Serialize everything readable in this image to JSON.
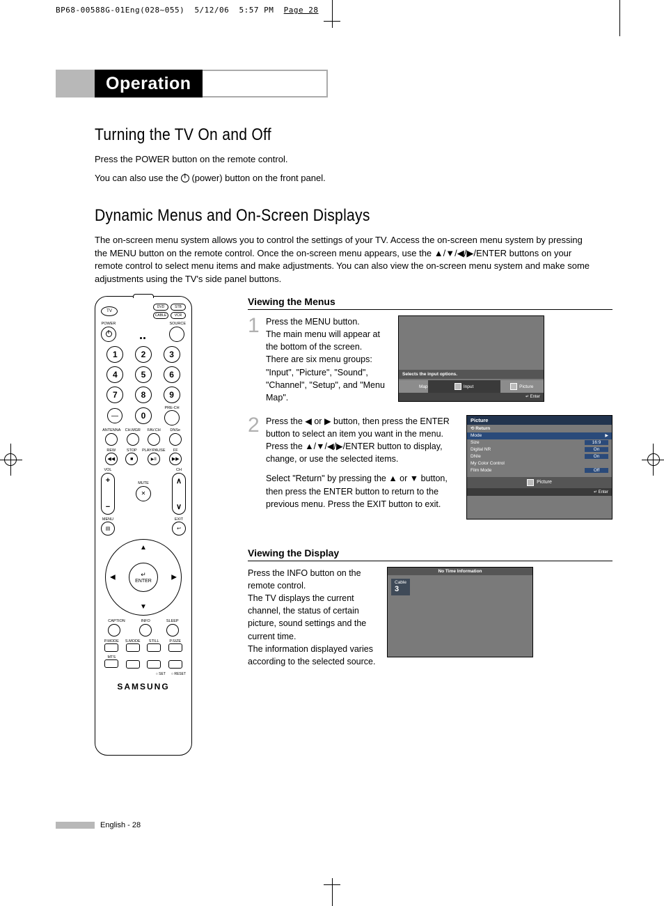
{
  "cropHeader": {
    "job": "BP68-00588G-01Eng(028~055)",
    "date": "5/12/06",
    "time": "5:57 PM",
    "page": "Page 28"
  },
  "sectionTitle": "Operation",
  "sub1": "Turning the TV On and Off",
  "sub1_p1": "Press the POWER button on the remote control.",
  "sub1_p2a": "You can also use the ",
  "sub1_p2b": " (power) button on the front panel.",
  "sub2": "Dynamic Menus and On-Screen Displays",
  "sub2_p": "The on-screen menu system allows you to control the settings of your TV. Access the on-screen menu system by pressing the MENU button on the remote control. Once the on-screen menu appears, use the ▲/▼/◀/▶/ENTER buttons on your remote control to select menu items and make adjustments. You can also view the on-screen menu system and make some adjustments using the TV's side panel buttons.",
  "viewingMenus": "Viewing the Menus",
  "step1_num": "1",
  "step1": "Press the MENU button.\nThe main menu will appear at the bottom of the screen.\nThere are six menu groups: \"Input\", \"Picture\", \"Sound\", \"Channel\", \"Setup\", and \"Menu Map\".",
  "step2_num": "2",
  "step2_p1": "Press the ◀ or ▶ button, then press the ENTER button to select an item you want in the menu.\nPress the ▲/▼/◀/▶/ENTER button to display, change, or use the selected items.",
  "step2_p2": "Select \"Return\" by pressing the ▲ or ▼ button, then press the ENTER button to return to the previous menu. Press the EXIT button to exit.",
  "viewingDisplay": "Viewing the Display",
  "disp_p": "Press the INFO button on the remote control.\nThe TV displays the current channel, the status of certain picture, sound settings and the current time.\nThe information displayed varies according to the selected source.",
  "remote": {
    "tv": "TV",
    "dvd": "DVD",
    "stb": "STB",
    "cable": "CABLE",
    "vcr": "VCR",
    "power": "POWER",
    "source": "SOURCE",
    "n1": "1",
    "n2": "2",
    "n3": "3",
    "n4": "4",
    "n5": "5",
    "n6": "6",
    "n7": "7",
    "n8": "8",
    "n9": "9",
    "n0": "0",
    "dash": "—",
    "prech": "PRE-CH",
    "antenna": "ANTENNA",
    "chmgr": "CH.MGR",
    "favch": "FAV.CH",
    "dnse": "DNSe",
    "rew": "REW",
    "stop": "STOP",
    "playpause": "PLAY/PAUSE",
    "ff": "FF",
    "vol": "VOL",
    "mute": "MUTE",
    "ch": "CH",
    "menu": "MENU",
    "exit": "EXIT",
    "enter": "ENTER",
    "caption": "CAPTION",
    "info": "INFO",
    "sleep": "SLEEP",
    "pmode": "P.MODE",
    "smode": "S.MODE",
    "still": "STILL",
    "psize": "P.SIZE",
    "mts": "MTS",
    "set": "SET",
    "reset": "RESET",
    "brand": "SAMSUNG"
  },
  "osd1": {
    "msg": "Selects the input options.",
    "left": "Map",
    "mid": "Input",
    "right": "Picture",
    "enter": "Enter"
  },
  "osd2": {
    "title": "Picture",
    "return": "Return",
    "rows": [
      {
        "k": "Mode",
        "v": ""
      },
      {
        "k": "Size",
        "v": "16:9"
      },
      {
        "k": "Digital NR",
        "v": "On"
      },
      {
        "k": "DNIe",
        "v": "On"
      },
      {
        "k": "My Color Control",
        "v": ""
      },
      {
        "k": "Film Mode",
        "v": "Off"
      }
    ],
    "pic": "Picture",
    "enter": "Enter"
  },
  "osd3": {
    "top": "No Time Information",
    "src": "Cable",
    "ch": "3"
  },
  "footer": "English - 28"
}
